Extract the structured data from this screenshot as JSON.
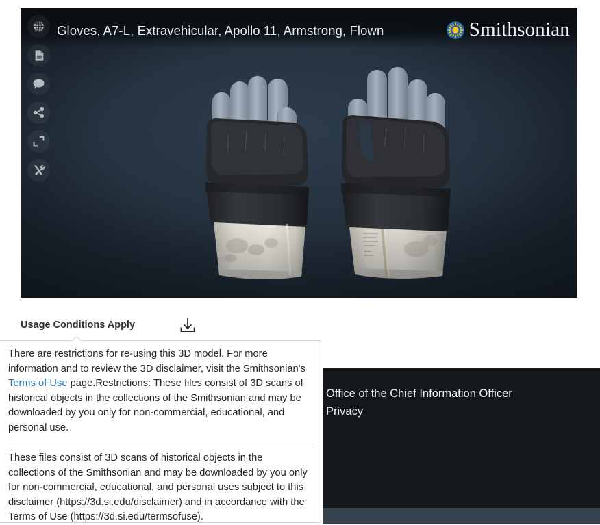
{
  "viewer": {
    "model_title": "Gloves, A7-L, Extravehicular, Apollo 11, Armstrong, Flown",
    "brand_name": "Smithsonian",
    "background_color": "#25323f",
    "header_color": "#0b0f14",
    "tools": [
      {
        "name": "globe-icon",
        "label": "Globe"
      },
      {
        "name": "document-icon",
        "label": "Document"
      },
      {
        "name": "comment-icon",
        "label": "Comment"
      },
      {
        "name": "share-icon",
        "label": "Share"
      },
      {
        "name": "fullscreen-icon",
        "label": "Fullscreen"
      },
      {
        "name": "tools-icon",
        "label": "Tools"
      }
    ]
  },
  "usage": {
    "label": "Usage Conditions Apply",
    "download_icon": "download-icon"
  },
  "disclaimer": {
    "paragraph_1_before_link": "There are restrictions for re-using this 3D model. For more information and to review the 3D disclaimer, visit the Smithsonian's ",
    "link_text": "Terms of Use",
    "paragraph_1_after_link": " page.Restrictions: These files consist of 3D scans of historical objects in the collections of the Smithsonian and may be downloaded by you only for non-commercial, educational, and personal use.",
    "paragraph_2": "These files consist of 3D scans of historical objects in the collections of the Smithsonian and may be downloaded by you only for non-commercial, educational, and personal uses subject to this disclaimer (https://3d.si.edu/disclaimer) and in accordance with the Terms of Use (https://3d.si.edu/termsofuse)."
  },
  "footer": {
    "background_color": "#14181c",
    "strip_color": "#35424e",
    "links": [
      "Office of the Chief Information Officer",
      "Privacy"
    ]
  },
  "brand_colors": {
    "sun_yellow": "#f7c325",
    "sun_blue": "#1b64a8",
    "link_blue": "#2a7cb8"
  }
}
